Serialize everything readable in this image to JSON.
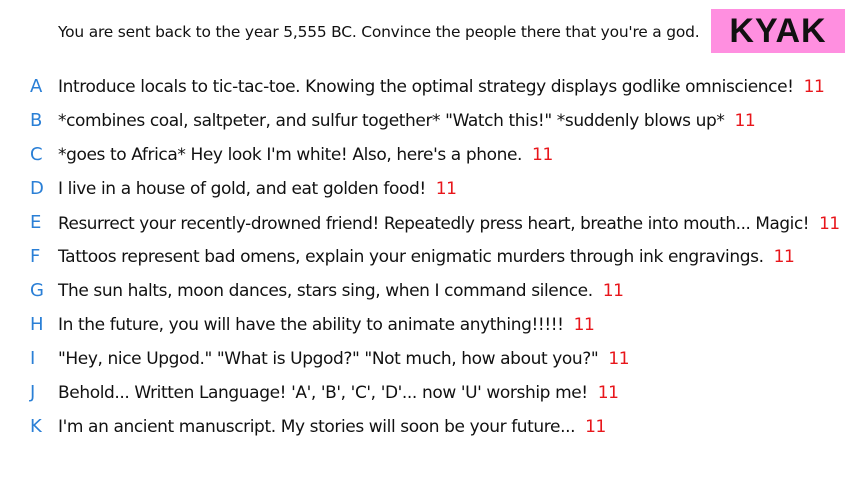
{
  "prompt": "You are sent back to the year 5,555 BC. Convince the people there that you're a god.",
  "badge": {
    "label": "KYAK",
    "color": "#ff8fe0"
  },
  "colors": {
    "letter": "#2a7fd6",
    "score": "#e8161b"
  },
  "answers": [
    {
      "letter": "A",
      "text": "Introduce locals to tic-tac-toe. Knowing the optimal strategy displays godlike omniscience!",
      "score": "11"
    },
    {
      "letter": "B",
      "text": "*combines coal, saltpeter, and sulfur together* \"Watch this!\" *suddenly blows up*",
      "score": "11"
    },
    {
      "letter": "C",
      "text": "*goes to Africa* Hey look I'm white! Also, here's a phone.",
      "score": "11"
    },
    {
      "letter": "D",
      "text": "I live in a house of gold, and eat golden food!",
      "score": "11"
    },
    {
      "letter": "E",
      "text": "Resurrect your recently-drowned friend! Repeatedly press heart, breathe into mouth... Magic!",
      "score": "11"
    },
    {
      "letter": "F",
      "text": "Tattoos represent bad omens, explain your enigmatic murders through ink engravings.",
      "score": "11"
    },
    {
      "letter": "G",
      "text": "The sun halts, moon dances, stars sing, when I command silence.",
      "score": "11"
    },
    {
      "letter": "H",
      "text": "In the future, you will have the ability to animate anything!!!!!",
      "score": "11"
    },
    {
      "letter": "I",
      "text": "\"Hey, nice Upgod.\" \"What is Upgod?\" \"Not much, how about you?\"",
      "score": "11"
    },
    {
      "letter": "J",
      "text": "Behold... Written Language! 'A', 'B', 'C', 'D'... now 'U' worship me!",
      "score": "11"
    },
    {
      "letter": "K",
      "text": "I'm an ancient manuscript. My stories will soon be your future...",
      "score": "11"
    }
  ]
}
